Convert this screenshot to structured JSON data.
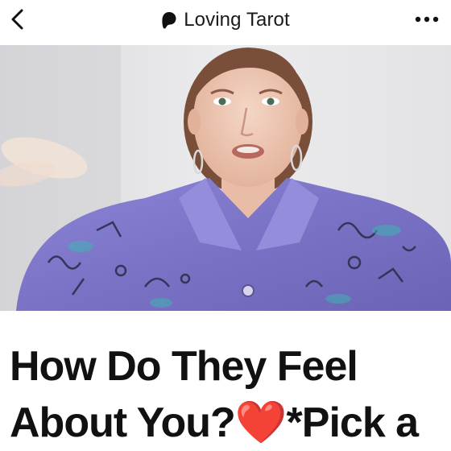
{
  "header": {
    "channel_name": "Loving Tarot",
    "back_icon": "chevron-left-icon",
    "channel_icon": "patreon-logo-icon",
    "more_icon": "more-horizontal-icon"
  },
  "video": {
    "thumbnail": "woman-in-patterned-purple-shirt"
  },
  "post": {
    "title": "How Do They Feel About You?❤️*Pick a"
  },
  "colors": {
    "background": "#ffffff",
    "text": "#111111",
    "shirt": "#7d76c8",
    "wall": "#e9e9eb"
  }
}
